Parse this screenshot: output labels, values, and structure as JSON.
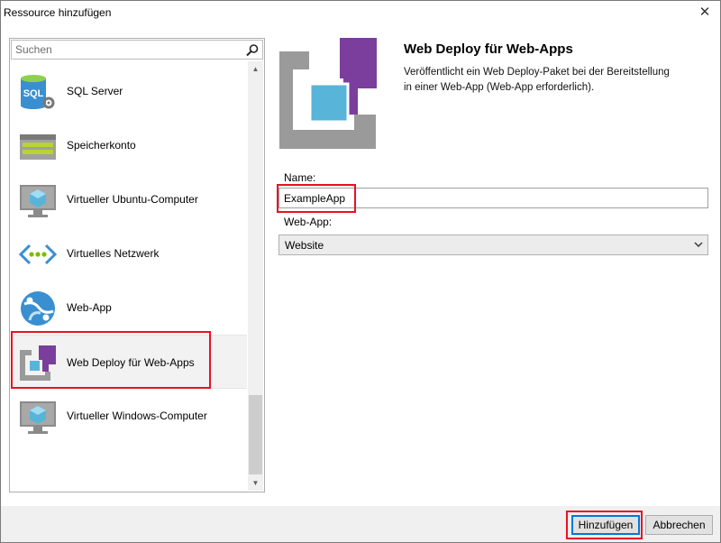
{
  "window": {
    "title": "Ressource hinzufügen",
    "close_label": "✕"
  },
  "search": {
    "placeholder": "Suchen"
  },
  "resources": [
    {
      "label": "SQL Server",
      "icon": "sql-server-icon"
    },
    {
      "label": "Speicherkonto",
      "icon": "storage-account-icon"
    },
    {
      "label": "Virtueller Ubuntu-Computer",
      "icon": "virtual-machine-icon"
    },
    {
      "label": "Virtuelles Netzwerk",
      "icon": "virtual-network-icon"
    },
    {
      "label": "Web-App",
      "icon": "web-app-icon"
    },
    {
      "label": "Web Deploy für Web-Apps",
      "icon": "web-deploy-icon",
      "selected": true
    },
    {
      "label": "Virtueller Windows-Computer",
      "icon": "virtual-machine-icon"
    }
  ],
  "detail": {
    "title": "Web Deploy für Web-Apps",
    "description": "Veröffentlicht ein Web Deploy-Paket bei der Bereitstellung in einer Web-App (Web-App erforderlich).",
    "name_label": "Name:",
    "name_value": "ExampleApp",
    "webapp_label": "Web-App:",
    "webapp_value": "Website"
  },
  "buttons": {
    "add": "Hinzufügen",
    "cancel": "Abbrechen"
  },
  "colors": {
    "highlight": "#e81123",
    "accent_purple": "#7b3e9c",
    "accent_blue": "#3a9bd5",
    "icon_gray": "#a0a0a0"
  }
}
